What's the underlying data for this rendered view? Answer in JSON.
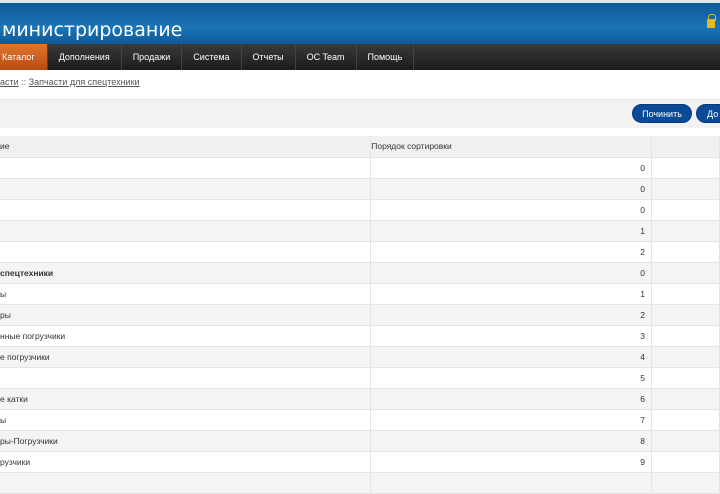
{
  "header": {
    "title": "министрирование",
    "lock_icon": "lock-icon"
  },
  "nav": [
    "Каталог",
    "Дополнения",
    "Продажи",
    "Система",
    "Отчеты",
    "OC Team",
    "Помощь"
  ],
  "breadcrumb": {
    "prefix": "асти",
    "sep": " :: ",
    "current": "Запчасти для спецтехники"
  },
  "toolbar": {
    "repair": "Починить",
    "add": "До"
  },
  "table": {
    "headers": [
      "ие",
      "Порядок сортировки",
      ""
    ],
    "rows": [
      {
        "name": "",
        "sort": "0"
      },
      {
        "name": "",
        "sort": "0"
      },
      {
        "name": "",
        "sort": "0"
      },
      {
        "name": "",
        "sort": "1"
      },
      {
        "name": "",
        "sort": "2"
      },
      {
        "name": " спецтехники",
        "sort": "0",
        "bold": true
      },
      {
        "name": "ы",
        "sort": "1"
      },
      {
        "name": "ры",
        "sort": "2"
      },
      {
        "name": "нные погрузчики",
        "sort": "3"
      },
      {
        "name": "е погрузчики",
        "sort": "4"
      },
      {
        "name": "",
        "sort": "5"
      },
      {
        "name": "е катки",
        "sort": "6"
      },
      {
        "name": "ы",
        "sort": "7"
      },
      {
        "name": "ры-Погрузчики",
        "sort": "8"
      },
      {
        "name": "рузчики",
        "sort": "9"
      },
      {
        "name": "",
        "sort": ""
      }
    ]
  }
}
